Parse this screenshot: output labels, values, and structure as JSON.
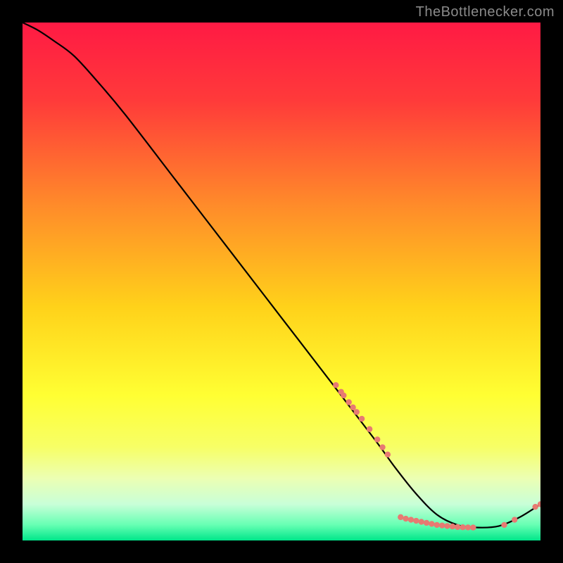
{
  "attribution": "TheBottlenecker.com",
  "chart_data": {
    "type": "line",
    "title": "",
    "xlabel": "",
    "ylabel": "",
    "xlim": [
      0,
      100
    ],
    "ylim": [
      0,
      100
    ],
    "background_gradient": {
      "stops": [
        {
          "offset": 0.0,
          "color": "#ff1a44"
        },
        {
          "offset": 0.15,
          "color": "#ff3a3a"
        },
        {
          "offset": 0.35,
          "color": "#ff8a2a"
        },
        {
          "offset": 0.55,
          "color": "#ffd21a"
        },
        {
          "offset": 0.72,
          "color": "#ffff33"
        },
        {
          "offset": 0.82,
          "color": "#f7ff66"
        },
        {
          "offset": 0.88,
          "color": "#ecffb3"
        },
        {
          "offset": 0.93,
          "color": "#c8ffd8"
        },
        {
          "offset": 0.97,
          "color": "#66ffb3"
        },
        {
          "offset": 1.0,
          "color": "#00e68a"
        }
      ]
    },
    "series": [
      {
        "name": "bottleneck-curve",
        "color": "#000000",
        "x": [
          0,
          3,
          6,
          10,
          15,
          20,
          30,
          40,
          50,
          60,
          68,
          72,
          76,
          80,
          84,
          88,
          92,
          96,
          100
        ],
        "y": [
          100,
          98.5,
          96.5,
          93.5,
          88,
          82,
          69,
          56,
          43,
          30,
          19.5,
          14,
          9,
          5,
          3,
          2.5,
          2.8,
          4.5,
          7
        ]
      }
    ],
    "markers": {
      "name": "highlight-points",
      "color": "#e77a72",
      "radius": 4.2,
      "points": [
        {
          "x": 60.5,
          "y": 30.0
        },
        {
          "x": 61.5,
          "y": 28.7
        },
        {
          "x": 62.0,
          "y": 28.0
        },
        {
          "x": 63.0,
          "y": 26.7
        },
        {
          "x": 63.8,
          "y": 25.7
        },
        {
          "x": 64.5,
          "y": 24.8
        },
        {
          "x": 65.5,
          "y": 23.5
        },
        {
          "x": 67.0,
          "y": 21.5
        },
        {
          "x": 68.5,
          "y": 19.5
        },
        {
          "x": 69.5,
          "y": 18.0
        },
        {
          "x": 70.5,
          "y": 16.6
        },
        {
          "x": 73.0,
          "y": 4.5
        },
        {
          "x": 74.0,
          "y": 4.2
        },
        {
          "x": 75.0,
          "y": 4.0
        },
        {
          "x": 76.0,
          "y": 3.8
        },
        {
          "x": 77.0,
          "y": 3.6
        },
        {
          "x": 78.0,
          "y": 3.4
        },
        {
          "x": 79.0,
          "y": 3.2
        },
        {
          "x": 80.0,
          "y": 3.0
        },
        {
          "x": 81.0,
          "y": 2.9
        },
        {
          "x": 82.0,
          "y": 2.8
        },
        {
          "x": 83.0,
          "y": 2.7
        },
        {
          "x": 84.0,
          "y": 2.6
        },
        {
          "x": 85.0,
          "y": 2.55
        },
        {
          "x": 86.0,
          "y": 2.52
        },
        {
          "x": 87.0,
          "y": 2.5
        },
        {
          "x": 93.0,
          "y": 3.0
        },
        {
          "x": 95.0,
          "y": 4.0
        },
        {
          "x": 99.0,
          "y": 6.5
        },
        {
          "x": 100.0,
          "y": 7.0
        }
      ]
    }
  }
}
